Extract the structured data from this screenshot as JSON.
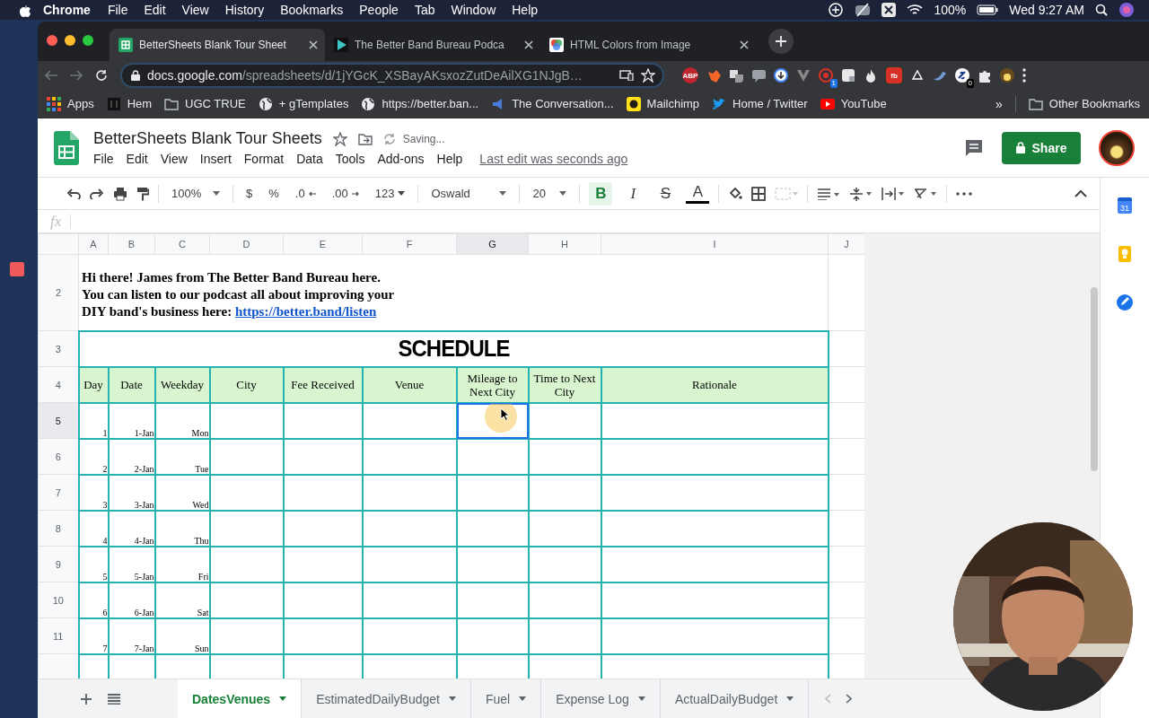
{
  "menubar": {
    "app": "Chrome",
    "items": [
      "File",
      "Edit",
      "View",
      "History",
      "Bookmarks",
      "People",
      "Tab",
      "Window",
      "Help"
    ],
    "battery": "100%",
    "clock": "Wed 9:27 AM"
  },
  "browser_tabs": [
    {
      "title": "BetterSheets Blank Tour Sheet",
      "kind": "sheets",
      "selected": true
    },
    {
      "title": "The Better Band Bureau Podca",
      "kind": "play",
      "selected": false
    },
    {
      "title": "HTML Colors from Image",
      "kind": "colors",
      "selected": false
    }
  ],
  "address_bar": {
    "host": "docs.google.com",
    "path": "/spreadsheets/d/1jYGcK_XSBayAKsxozZutDeAilXG1NJgB…"
  },
  "extensions": [
    {
      "kind": "abp",
      "label": "ABP"
    },
    {
      "kind": "fox"
    },
    {
      "kind": "translate"
    },
    {
      "kind": "bubble"
    },
    {
      "kind": "download"
    },
    {
      "kind": "vee"
    },
    {
      "kind": "target",
      "badge": "1"
    },
    {
      "kind": "square"
    },
    {
      "kind": "flame"
    },
    {
      "kind": "fb",
      "label": "fb"
    },
    {
      "kind": "triangle"
    },
    {
      "kind": "bird"
    },
    {
      "kind": "link",
      "badge": "0"
    },
    {
      "kind": "puzzle"
    },
    {
      "kind": "avatar"
    }
  ],
  "bookmarks": [
    {
      "label": "Apps",
      "kind": "apps"
    },
    {
      "label": "Hem",
      "kind": "dark"
    },
    {
      "label": "UGC TRUE",
      "kind": "folder"
    },
    {
      "label": "+ gTemplates",
      "kind": "globe"
    },
    {
      "label": "https://better.ban...",
      "kind": "globe"
    },
    {
      "label": "The Conversation...",
      "kind": "speaker"
    },
    {
      "label": "Mailchimp",
      "kind": "chimp"
    },
    {
      "label": "Home / Twitter",
      "kind": "twitter"
    },
    {
      "label": "YouTube",
      "kind": "youtube"
    }
  ],
  "bookmarks_more": "»",
  "other_bookmarks": "Other Bookmarks",
  "document": {
    "title": "BetterSheets Blank Tour Sheets",
    "status": "Saving...",
    "menu": [
      "File",
      "Edit",
      "View",
      "Insert",
      "Format",
      "Data",
      "Tools",
      "Add-ons",
      "Help"
    ],
    "last_edit": "Last edit was seconds ago",
    "share": "Share"
  },
  "toolbar": {
    "zoom": "100%",
    "number_buttons": [
      "$",
      "%",
      ".0",
      ".00",
      "123"
    ],
    "font": "Oswald",
    "font_size": "20",
    "format_buttons": [
      {
        "label": "B",
        "kind": "bold",
        "selected": true
      },
      {
        "label": "I",
        "kind": "italic",
        "selected": false
      },
      {
        "label": "S",
        "kind": "strike",
        "selected": false
      },
      {
        "label": "A",
        "kind": "color",
        "selected": false
      }
    ]
  },
  "formula_bar": {
    "label": "fx"
  },
  "side_panel": {
    "calendar_day": "31"
  },
  "grid": {
    "columns": [
      {
        "label": "A",
        "selected": false
      },
      {
        "label": "B",
        "selected": false
      },
      {
        "label": "C",
        "selected": false
      },
      {
        "label": "D",
        "selected": false
      },
      {
        "label": "E",
        "selected": false
      },
      {
        "label": "F",
        "selected": false
      },
      {
        "label": "G",
        "selected": true
      },
      {
        "label": "H",
        "selected": false
      },
      {
        "label": "I",
        "selected": false
      },
      {
        "label": "J",
        "selected": false
      }
    ],
    "intro": {
      "row": "2",
      "lines": [
        "Hi there! James from The Better Band Bureau here.",
        "You can listen to our podcast all about improving your",
        "DIY band's business here:"
      ],
      "link": "https://better.band/listen"
    },
    "title": {
      "row": "3",
      "text": "SCHEDULE"
    },
    "header": {
      "row": "4",
      "cells": [
        "Day",
        "Date",
        "Weekday",
        "City",
        "Fee Received",
        "Venue",
        "Mileage to Next City",
        "Time to Next City",
        "Rationale"
      ]
    },
    "rows": [
      {
        "row": "5",
        "day": "1",
        "date": "1-Jan",
        "weekday": "Mon",
        "selected": true
      },
      {
        "row": "6",
        "day": "2",
        "date": "2-Jan",
        "weekday": "Tue",
        "selected": false
      },
      {
        "row": "7",
        "day": "3",
        "date": "3-Jan",
        "weekday": "Wed",
        "selected": false
      },
      {
        "row": "8",
        "day": "4",
        "date": "4-Jan",
        "weekday": "Thu",
        "selected": false
      },
      {
        "row": "9",
        "day": "5",
        "date": "5-Jan",
        "weekday": "Fri",
        "selected": false
      },
      {
        "row": "10",
        "day": "6",
        "date": "6-Jan",
        "weekday": "Sat",
        "selected": false
      },
      {
        "row": "11",
        "day": "7",
        "date": "7-Jan",
        "weekday": "Sun",
        "selected": false
      }
    ]
  },
  "sheet_tabs": [
    {
      "label": "DatesVenues",
      "selected": true
    },
    {
      "label": "EstimatedDailyBudget",
      "selected": false
    },
    {
      "label": "Fuel",
      "selected": false
    },
    {
      "label": "Expense Log",
      "selected": false
    },
    {
      "label": "ActualDailyBudget",
      "selected": false
    }
  ]
}
